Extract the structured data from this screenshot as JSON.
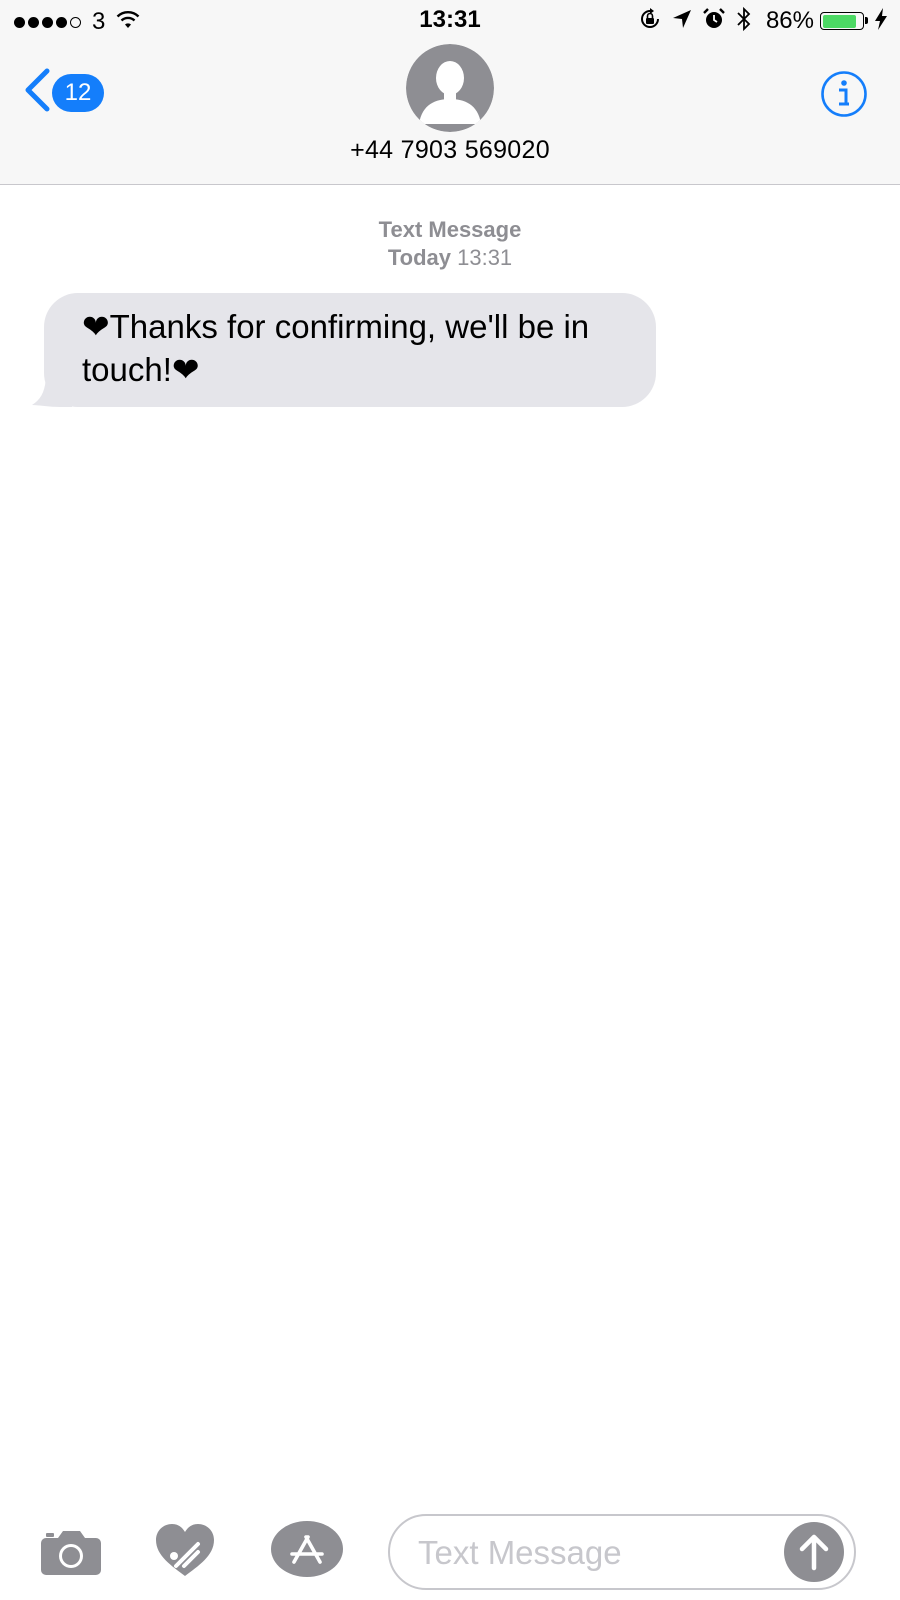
{
  "status_bar": {
    "carrier": "3",
    "signal_bars_filled": 4,
    "signal_bars_total": 5,
    "time": "13:31",
    "battery_percent_label": "86%",
    "battery_level": 0.86,
    "icons": [
      "wifi-icon",
      "orientation-lock-icon",
      "location-arrow-icon",
      "alarm-icon",
      "bluetooth-icon",
      "charging-bolt-icon"
    ]
  },
  "nav": {
    "back_badge": "12",
    "contact": "+44 7903 569020",
    "accent_color": "#147efb"
  },
  "thread": {
    "service": "Text Message",
    "day": "Today",
    "time": "13:31",
    "messages": [
      {
        "direction": "incoming",
        "text": "❤Thanks for confirming, we'll be in touch!❤"
      }
    ]
  },
  "composer": {
    "placeholder": "Text Message",
    "icons": [
      "camera-icon",
      "digital-touch-icon",
      "app-store-icon",
      "send-arrow-icon"
    ]
  },
  "colors": {
    "incoming_bubble": "#e5e5ea",
    "meta_text": "#8e8e93",
    "battery_fill": "#4cd964"
  }
}
